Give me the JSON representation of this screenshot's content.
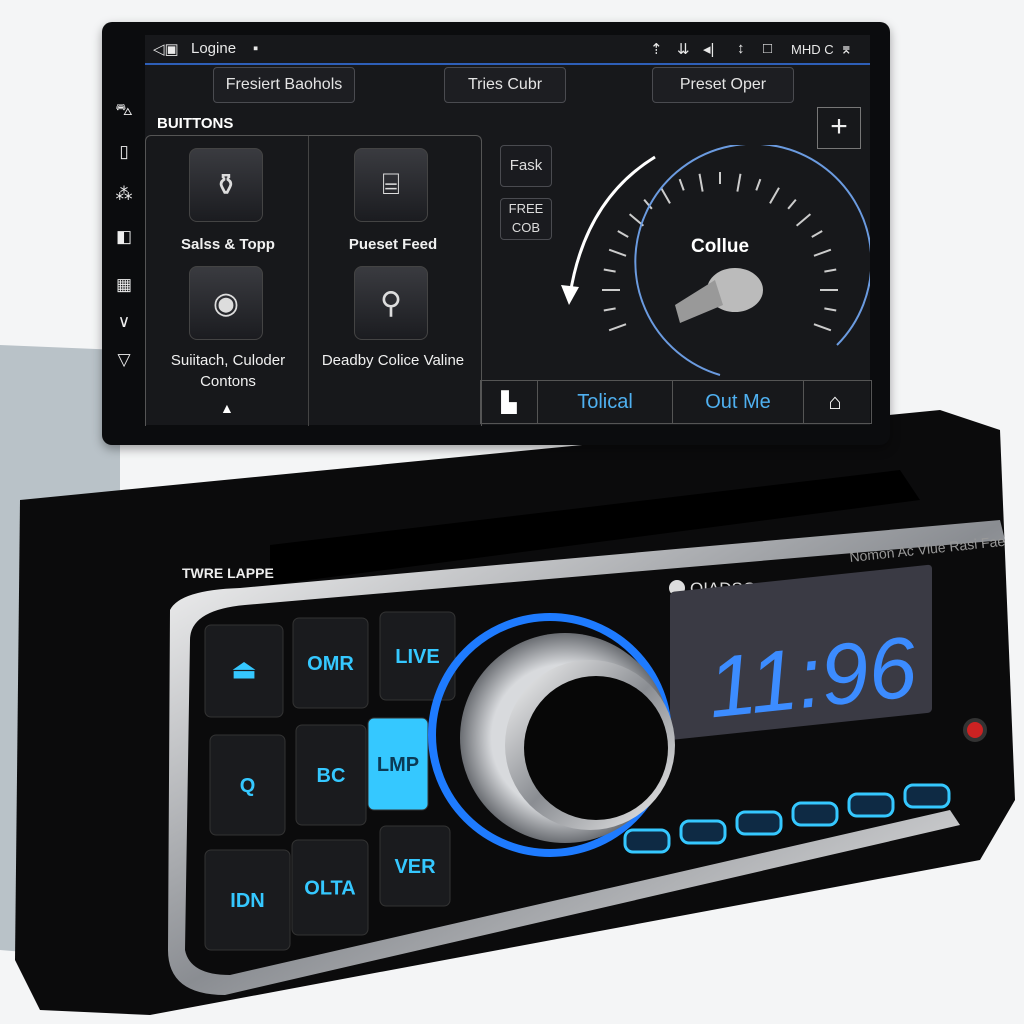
{
  "screen": {
    "status_bar": {
      "back_icon": "back-arrow-icon",
      "title": "Logine",
      "right_icons": [
        "navigation-icon",
        "signal-icon",
        "volume-icon",
        "updown-icon",
        "square-icon"
      ],
      "right_text": "MHD C",
      "end_icon": "profile-icon"
    },
    "top_buttons": [
      "Fresiert Baohols",
      "Tries Cubr",
      "Preset Oper"
    ],
    "add_button": "+",
    "section_title": "BUITTONS",
    "sidebar_icons": [
      "car-icon",
      "phone-icon",
      "apps-icon",
      "split-icon",
      "map-icon",
      "chevron-down-icon",
      "triangle-down-icon"
    ],
    "tiles": [
      {
        "label": "Salss & Topp",
        "icon": "bottles-icon"
      },
      {
        "label": "Pueset Feed",
        "icon": "cabinet-icon"
      },
      {
        "label": "Suiitach, Culoder Contons",
        "icon": "face-circle-icon"
      },
      {
        "label": "Deadby Colice Valine",
        "icon": "bow-icon"
      }
    ],
    "small_buttons": [
      "Fask",
      "FREE COB"
    ],
    "dial_label": "Collue",
    "bottom_bar": {
      "left_icon": "seat-icon",
      "tab1": "Tolical",
      "tab2": "Out Me",
      "home_icon": "home-icon"
    },
    "accent": "#4fb0f0"
  },
  "stereo": {
    "brand_left": "TWRE LAPPE",
    "logo": "OIADSO",
    "tagline": "Nomon Ac Vlue Rasi Fae",
    "clock": "11:96",
    "buttons": [
      "OMR",
      "LIVE",
      "Q",
      "BC",
      "LMP",
      "IDN",
      "OLTA",
      "VER"
    ],
    "lit_button": "LMP",
    "accent": "#35c8ff",
    "display_color": "#3c8cff"
  }
}
